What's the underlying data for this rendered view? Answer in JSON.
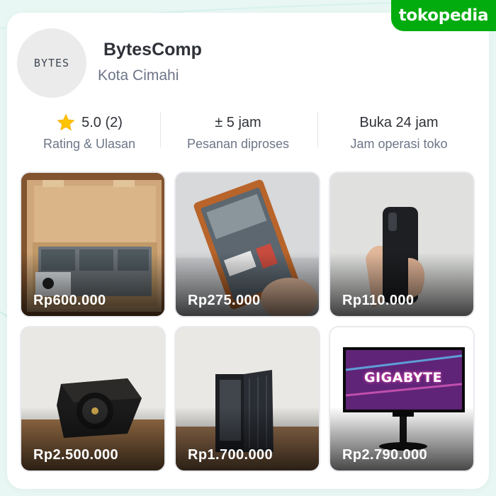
{
  "brand": {
    "name": "tokopedia",
    "color": "#03ac0e"
  },
  "shop": {
    "avatar_text": "BYTES",
    "name": "BytesComp",
    "city": "Kota Cimahi"
  },
  "stats": [
    {
      "value": "5.0 (2)",
      "label": "Rating & Ulasan",
      "icon": "star-icon"
    },
    {
      "value": "± 5 jam",
      "label": "Pesanan diproses"
    },
    {
      "value": "Buka 24 jam",
      "label": "Jam operasi toko"
    }
  ],
  "products": [
    {
      "price": "Rp600.000",
      "image": "laptop-battery-in-box"
    },
    {
      "price": "Rp275.000",
      "image": "phone-battery"
    },
    {
      "price": "Rp110.000",
      "image": "phone-case"
    },
    {
      "price": "Rp2.500.000",
      "image": "power-supply-unit"
    },
    {
      "price": "Rp1.700.000",
      "image": "pc-case"
    },
    {
      "price": "Rp2.790.000",
      "image": "gigabyte-monitor",
      "monitor_text": "GIGABYTE"
    }
  ]
}
